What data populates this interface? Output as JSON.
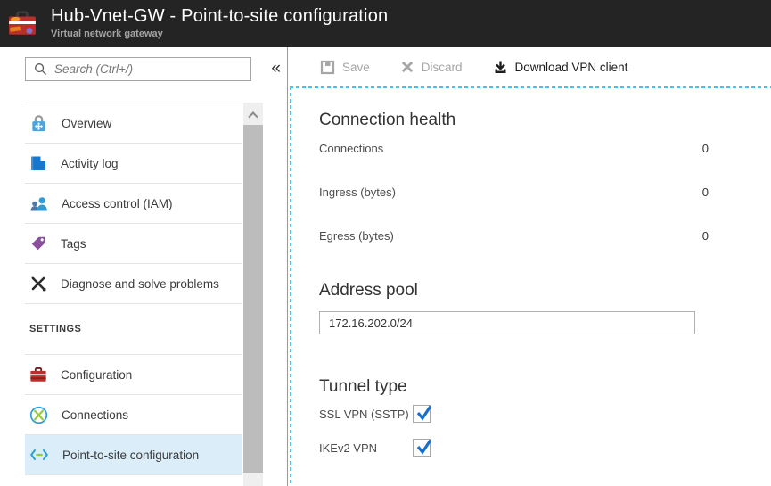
{
  "header": {
    "title": "Hub-Vnet-GW - Point-to-site configuration",
    "subtitle": "Virtual network gateway"
  },
  "sidebar": {
    "search": {
      "placeholder": "Search (Ctrl+/)"
    },
    "collapse_label": "«",
    "items": [
      {
        "label": "Overview",
        "icon": "overview-lock-icon"
      },
      {
        "label": "Activity log",
        "icon": "activity-log-icon"
      },
      {
        "label": "Access control (IAM)",
        "icon": "access-control-icon"
      },
      {
        "label": "Tags",
        "icon": "tags-icon"
      },
      {
        "label": "Diagnose and solve problems",
        "icon": "diagnose-icon"
      }
    ],
    "section_label": "SETTINGS",
    "settings_items": [
      {
        "label": "Configuration",
        "icon": "configuration-icon",
        "selected": false
      },
      {
        "label": "Connections",
        "icon": "connections-icon",
        "selected": false
      },
      {
        "label": "Point-to-site configuration",
        "icon": "point-to-site-icon",
        "selected": true
      }
    ]
  },
  "toolbar": {
    "save_label": "Save",
    "discard_label": "Discard",
    "download_label": "Download VPN client",
    "save_enabled": false,
    "discard_enabled": false
  },
  "main": {
    "connection_health": {
      "title": "Connection health",
      "rows": [
        {
          "label": "Connections",
          "value": "0"
        },
        {
          "label": "Ingress (bytes)",
          "value": "0"
        },
        {
          "label": "Egress (bytes)",
          "value": "0"
        }
      ]
    },
    "address_pool": {
      "title": "Address pool",
      "value": "172.16.202.0/24"
    },
    "tunnel_type": {
      "title": "Tunnel type",
      "options": [
        {
          "label": "SSL VPN (SSTP)",
          "checked": true
        },
        {
          "label": "IKEv2 VPN",
          "checked": true
        }
      ]
    }
  },
  "colors": {
    "header_bg": "#242424",
    "accent_dash": "#44c3f1",
    "selected_bg": "#daedf8",
    "checkbox_check": "#1670c9",
    "icon_blue": "#2ba0d8",
    "icon_green": "#8dc63f",
    "icon_red": "#b8302c",
    "icon_purple": "#8b4d9e"
  }
}
